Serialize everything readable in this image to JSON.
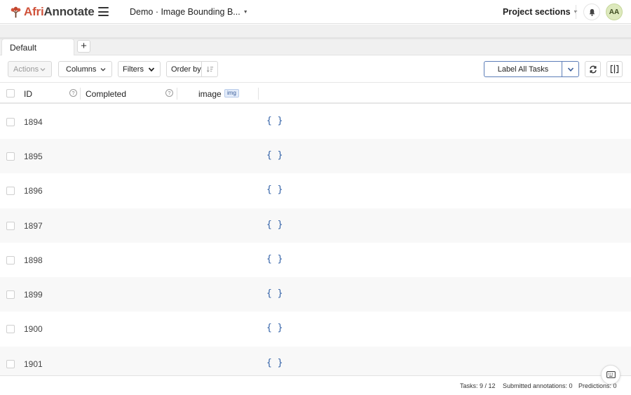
{
  "app": {
    "logo_part1": "Afri",
    "logo_part2": "Annotate",
    "project_title": "Demo · Image Bounding B...",
    "project_sections": "Project sections",
    "avatar_initials": "AA",
    "brand_color": "#d0533b"
  },
  "tabs": [
    {
      "label": "Default",
      "active": true
    }
  ],
  "tab_add_label": "+",
  "toolbar": {
    "actions_label": "Actions",
    "columns_label": "Columns",
    "filters_label": "Filters",
    "order_by_label": "Order by",
    "label_all_label": "Label All Tasks",
    "accent_color": "#5d7eb8"
  },
  "table": {
    "columns": {
      "id": "ID",
      "completed": "Completed",
      "image": "image",
      "image_badge": "img"
    },
    "rows": [
      {
        "id": "1894",
        "data": "{ }"
      },
      {
        "id": "1895",
        "data": "{ }"
      },
      {
        "id": "1896",
        "data": "{ }"
      },
      {
        "id": "1897",
        "data": "{ }"
      },
      {
        "id": "1898",
        "data": "{ }"
      },
      {
        "id": "1899",
        "data": "{ }"
      },
      {
        "id": "1900",
        "data": "{ }"
      },
      {
        "id": "1901",
        "data": "{ }"
      }
    ]
  },
  "footer": {
    "tasks": "Tasks: 9 / 12",
    "submitted": "Submitted annotations: 0",
    "predictions": "Predictions: 0"
  }
}
